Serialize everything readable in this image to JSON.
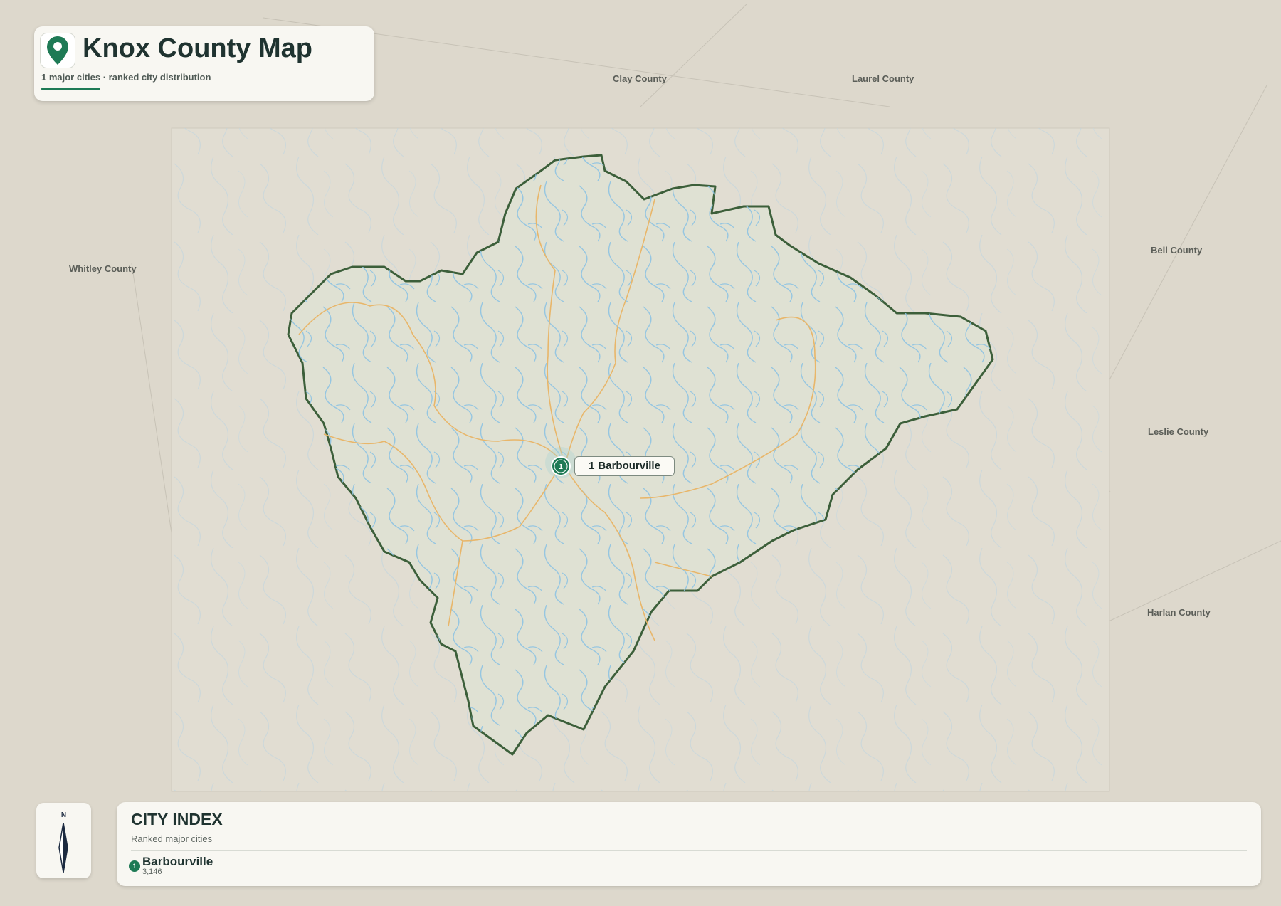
{
  "header": {
    "title": "Knox County Map",
    "subtitle": "1 major cities · ranked city distribution"
  },
  "map": {
    "county": "Knox County",
    "neighbors": [
      "Clay County",
      "Laurel County",
      "Whitley County",
      "Bell County",
      "Leslie County",
      "Harlan County"
    ],
    "cities": [
      {
        "rank": "1",
        "name": "Barbourville",
        "population": "3,146"
      }
    ],
    "colors": {
      "background": "#ddd8cc",
      "county_fill": "#dfe1d3",
      "county_border": "#3c5f3a",
      "rivers": "#8ec3e2",
      "roads": "#e8b66a",
      "accent": "#1e7a55"
    },
    "icons": [
      "map-pin-icon",
      "compass-icon"
    ]
  },
  "compass": {
    "north_label": "N"
  },
  "city_index": {
    "title": "CITY INDEX",
    "subtitle": "Ranked major cities"
  }
}
